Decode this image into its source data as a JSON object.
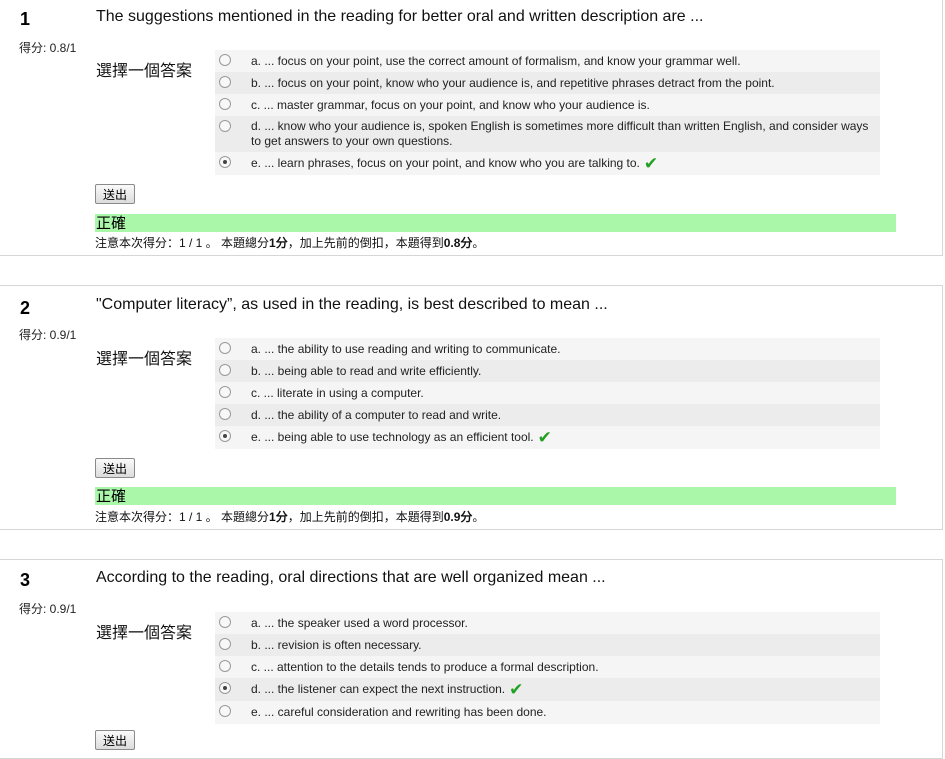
{
  "questions": [
    {
      "number": "1",
      "grade": "得分: 0.8/1",
      "text": "The suggestions mentioned in the reading for better oral and written description are ...",
      "prompt": "選擇一個答案",
      "options": [
        {
          "label": "a. ... focus on your point, use the correct amount of formalism, and know your grammar well.",
          "selected": false,
          "correct": false
        },
        {
          "label": "b. ... focus on your point, know who your audience is, and repetitive phrases detract from the point.",
          "selected": false,
          "correct": false
        },
        {
          "label": "c. ... master grammar, focus on your point, and know who your audience is.",
          "selected": false,
          "correct": false
        },
        {
          "label": "d. ... know who your audience is, spoken English is sometimes more difficult than written English, and consider ways to get answers to your own questions.",
          "selected": false,
          "correct": false
        },
        {
          "label": "e. ... learn phrases, focus on your point, and know who you are talking to.",
          "selected": true,
          "correct": true
        }
      ],
      "submit_label": "送出",
      "result_label": "正確",
      "score_prefix": "注意本次得分：1 / 1 。 本題總分",
      "score_total": "1分",
      "score_middle": "，加上先前的倒扣，本題得到",
      "score_final": "0.8分",
      "score_suffix": "。"
    },
    {
      "number": "2",
      "grade": "得分: 0.9/1",
      "text": "\"Computer literacy”, as used in the reading, is best described to mean ...",
      "prompt": "選擇一個答案",
      "options": [
        {
          "label": "a. ... the ability to use reading and writing to communicate.",
          "selected": false,
          "correct": false
        },
        {
          "label": "b. ... being able to read and write efficiently.",
          "selected": false,
          "correct": false
        },
        {
          "label": "c. ... literate in using a computer.",
          "selected": false,
          "correct": false
        },
        {
          "label": "d. ... the ability of a computer to read and write.",
          "selected": false,
          "correct": false
        },
        {
          "label": "e. ... being able to use technology as an efficient tool.",
          "selected": true,
          "correct": true
        }
      ],
      "submit_label": "送出",
      "result_label": "正確",
      "score_prefix": "注意本次得分：1 / 1 。 本題總分",
      "score_total": "1分",
      "score_middle": "，加上先前的倒扣，本題得到",
      "score_final": "0.9分",
      "score_suffix": "。"
    },
    {
      "number": "3",
      "grade": "得分: 0.9/1",
      "text": "According to the reading, oral directions that are well organized mean ...",
      "prompt": "選擇一個答案",
      "options": [
        {
          "label": "a. ... the speaker used a word processor.",
          "selected": false,
          "correct": false
        },
        {
          "label": "b. ... revision is often necessary.",
          "selected": false,
          "correct": false
        },
        {
          "label": "c. ... attention to the details tends to produce a formal description.",
          "selected": false,
          "correct": false
        },
        {
          "label": "d. ... the listener can expect the next instruction.",
          "selected": true,
          "correct": true
        },
        {
          "label": "e. ... careful consideration and rewriting has been done.",
          "selected": false,
          "correct": false
        }
      ],
      "submit_label": "送出"
    }
  ],
  "check_glyph": "✔",
  "colors": {
    "correct_bg": "#aaf7aa",
    "check": "#22a022"
  }
}
